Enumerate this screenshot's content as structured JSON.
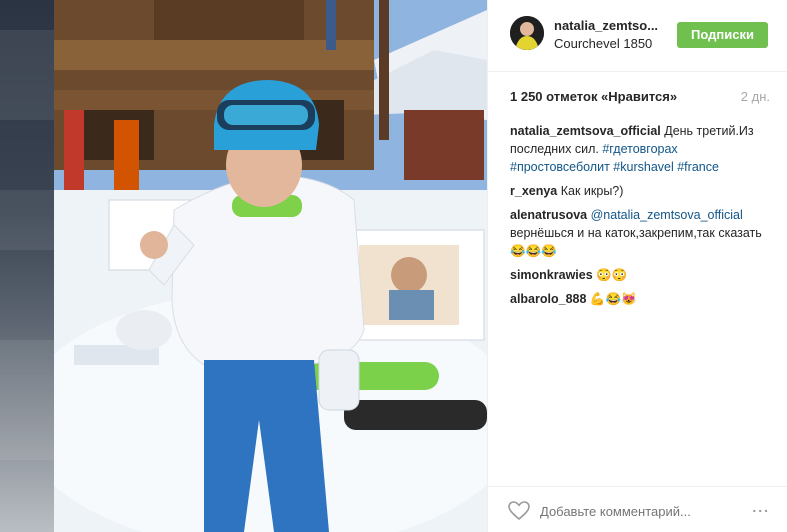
{
  "post": {
    "username": "natalia_zemtso...",
    "location": "Courchevel 1850",
    "follow_label": "Подписки",
    "likes": "1 250 отметок «Нравится»",
    "time": "2 дн."
  },
  "comments": [
    {
      "author": "natalia_zemtsova_official",
      "segments": [
        {
          "text": " День третий.Из последних сил. ",
          "tag": false
        },
        {
          "text": "#гдетовгорах",
          "tag": true
        },
        {
          "text": " ",
          "tag": false
        },
        {
          "text": "#простовсеболит",
          "tag": true
        },
        {
          "text": " ",
          "tag": false
        },
        {
          "text": "#kurshavel",
          "tag": true
        },
        {
          "text": " ",
          "tag": false
        },
        {
          "text": "#france",
          "tag": true
        }
      ]
    },
    {
      "author": "r_xenya",
      "segments": [
        {
          "text": " Как икры?)",
          "tag": false
        }
      ]
    },
    {
      "author": "alenatrusova",
      "segments": [
        {
          "text": " ",
          "tag": false
        },
        {
          "text": "@natalia_zemtsova_official",
          "tag": true
        },
        {
          "text": " вернёшься и на каток,закрепим,так сказать😂😂😂",
          "tag": false
        }
      ]
    },
    {
      "author": "simonkrawies",
      "segments": [
        {
          "text": " 😳😳",
          "tag": false
        }
      ]
    },
    {
      "author": "albarolo_888",
      "segments": [
        {
          "text": " 💪😂😻",
          "tag": false
        }
      ]
    }
  ],
  "comment_bar": {
    "placeholder": "Добавьте комментарий...",
    "more_label": "..."
  },
  "colors": {
    "follow_button": "#70c050",
    "hashtag": "#125688",
    "secondary_text": "#a5a7aa"
  },
  "icons": [
    "heart-icon",
    "more-options-icon"
  ]
}
